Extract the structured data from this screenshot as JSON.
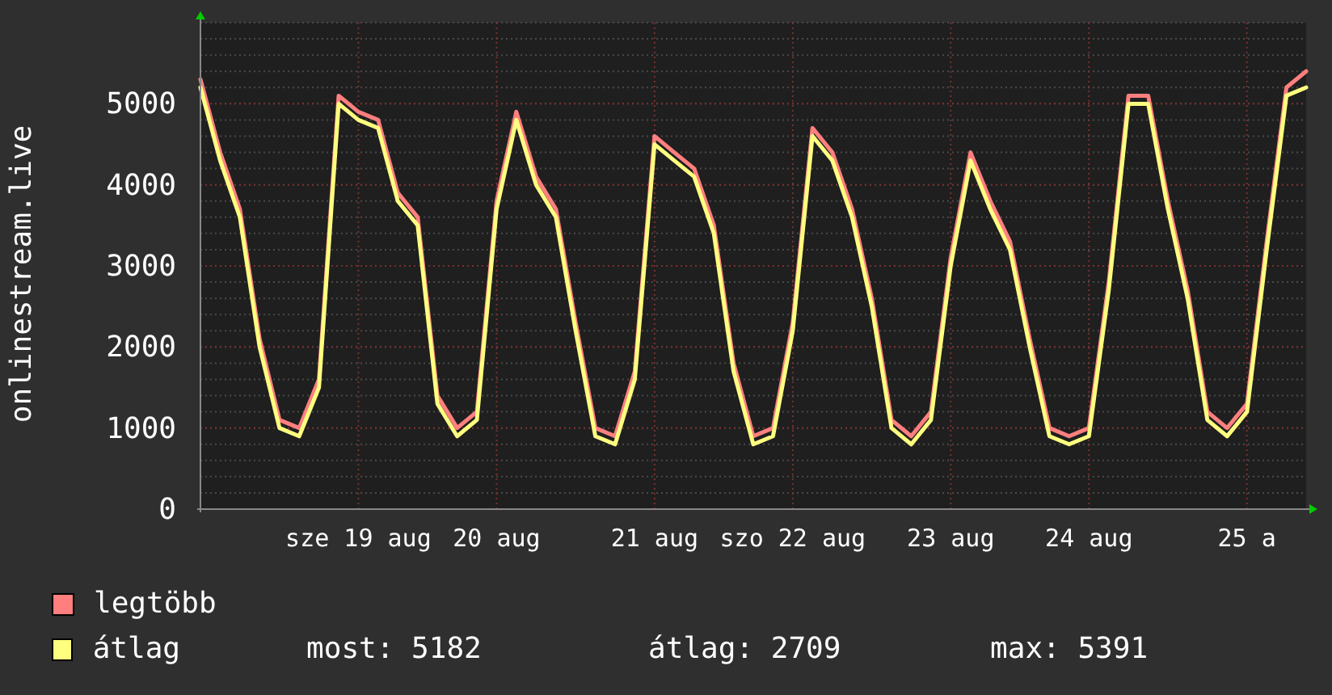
{
  "chart": {
    "chart_data": {
      "type": "line",
      "grid": true,
      "ylabel": "onlinestream.live",
      "ylim": [
        0,
        6000
      ],
      "yticks": [
        0,
        1000,
        2000,
        3000,
        4000,
        5000
      ],
      "categories": [
        null,
        null,
        null,
        null,
        null,
        null,
        null,
        null,
        "sze 19 aug",
        null,
        null,
        null,
        null,
        null,
        null,
        "20 aug",
        null,
        null,
        null,
        null,
        null,
        null,
        null,
        "21 aug",
        null,
        null,
        null,
        null,
        null,
        null,
        "szo 22 aug",
        null,
        null,
        null,
        null,
        null,
        null,
        null,
        "23 aug",
        null,
        null,
        null,
        null,
        null,
        null,
        "24 aug",
        null,
        null,
        null,
        null,
        null,
        null,
        null,
        "25 a",
        null,
        null,
        null
      ],
      "series": [
        {
          "name": "legtöbb",
          "color": "#ff7f7f",
          "values": [
            5300,
            4400,
            3700,
            2100,
            1100,
            1000,
            1600,
            5100,
            4900,
            4800,
            3900,
            3600,
            1400,
            1000,
            1200,
            3800,
            4900,
            4100,
            3700,
            2300,
            1000,
            900,
            1700,
            4600,
            4400,
            4200,
            3500,
            1800,
            900,
            1000,
            2300,
            4700,
            4400,
            3700,
            2600,
            1100,
            900,
            1200,
            3100,
            4400,
            3800,
            3300,
            2100,
            1000,
            900,
            1000,
            2800,
            5100,
            5100,
            3800,
            2700,
            1200,
            1000,
            1300,
            3300,
            5200,
            5400
          ]
        },
        {
          "name": "átlag",
          "color": "#ffff7f",
          "values": [
            5200,
            4300,
            3600,
            2000,
            1000,
            900,
            1500,
            5000,
            4800,
            4700,
            3800,
            3500,
            1300,
            900,
            1100,
            3700,
            4800,
            4000,
            3600,
            2200,
            900,
            800,
            1600,
            4500,
            4300,
            4100,
            3400,
            1700,
            800,
            900,
            2200,
            4600,
            4300,
            3600,
            2500,
            1000,
            800,
            1100,
            3000,
            4300,
            3700,
            3200,
            2000,
            900,
            800,
            900,
            2700,
            5000,
            5000,
            3700,
            2600,
            1100,
            900,
            1200,
            3200,
            5100,
            5200
          ]
        }
      ]
    }
  },
  "stats": [
    "most: 5182",
    "átlag: 2709",
    "max: 5391"
  ]
}
